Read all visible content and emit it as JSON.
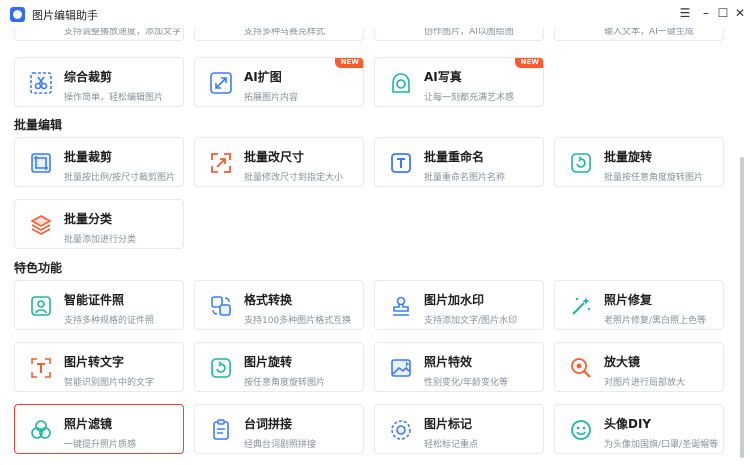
{
  "window": {
    "title": "图片编辑助手"
  },
  "top_partial": [
    {
      "desc": "支持调整播放速度，添加文字",
      "color": "#3a7bff"
    },
    {
      "desc": "支持多种马赛克样式",
      "color": "#18b7a5"
    },
    {
      "desc": "创作图片，AI以图绘图",
      "color": "#ff5a2b"
    },
    {
      "desc": "输入文本，AI一键生成",
      "color": "#3a7bff"
    }
  ],
  "featured": [
    {
      "name": "综合裁剪",
      "desc": "操作简单，轻松编辑图片",
      "icon": "crop-scissors-icon",
      "color": "#3a7bff"
    },
    {
      "name": "AI扩图",
      "desc": "拓展图片内容",
      "icon": "expand-arrows-icon",
      "color": "#3a7bff",
      "badge": "NEW"
    },
    {
      "name": "AI写真",
      "desc": "让每一刻都充满艺术感",
      "icon": "portrait-icon",
      "color": "#18b7a5",
      "badge": "NEW"
    }
  ],
  "batch": {
    "title": "批量编辑",
    "items": [
      {
        "name": "批量裁剪",
        "desc": "批量按比例/按尺寸裁剪图片",
        "icon": "batch-crop-icon",
        "color": "#3a7bff"
      },
      {
        "name": "批量改尺寸",
        "desc": "批量修改尺寸到指定大小",
        "icon": "resize-icon",
        "color": "#ff5a2b"
      },
      {
        "name": "批量重命名",
        "desc": "批量重命名图片名称",
        "icon": "rename-icon",
        "color": "#3a7bff"
      },
      {
        "name": "批量旋转",
        "desc": "批量按任意角度旋转图片",
        "icon": "rotate-icon",
        "color": "#18b7a5"
      },
      {
        "name": "批量分类",
        "desc": "批量添加进行分类",
        "icon": "layers-icon",
        "color": "#ff5a2b"
      }
    ]
  },
  "features": {
    "title": "特色功能",
    "items": [
      {
        "name": "智能证件照",
        "desc": "支持多种规格的证件照",
        "icon": "id-photo-icon",
        "color": "#18b7a5"
      },
      {
        "name": "格式转换",
        "desc": "支持100多种图片格式互换",
        "icon": "format-convert-icon",
        "color": "#3a7bff"
      },
      {
        "name": "图片加水印",
        "desc": "支持添加文字/图片水印",
        "icon": "watermark-stamp-icon",
        "color": "#3a7bff"
      },
      {
        "name": "照片修复",
        "desc": "老照片修复/黑白照上色等",
        "icon": "magic-wand-icon",
        "color": "#18b7a5"
      },
      {
        "name": "图片转文字",
        "desc": "智能识别图片中的文字",
        "icon": "text-ocr-icon",
        "color": "#ff5a2b"
      },
      {
        "name": "图片旋转",
        "desc": "按任意角度旋转图片",
        "icon": "rotate-image-icon",
        "color": "#18b7a5"
      },
      {
        "name": "照片特效",
        "desc": "性别变化/年龄变化等",
        "icon": "image-effect-icon",
        "color": "#3a7bff"
      },
      {
        "name": "放大镜",
        "desc": "对图片进行局部放大",
        "icon": "magnifier-icon",
        "color": "#ff5a2b"
      },
      {
        "name": "照片滤镜",
        "desc": "一键提升照片质感",
        "icon": "filter-circles-icon",
        "color": "#18b7a5",
        "selected": true
      },
      {
        "name": "台词拼接",
        "desc": "经典台词剧照拼接",
        "icon": "clipboard-icon",
        "color": "#3a7bff"
      },
      {
        "name": "图片标记",
        "desc": "轻松标记重点",
        "icon": "target-mark-icon",
        "color": "#3a7bff"
      },
      {
        "name": "头像DIY",
        "desc": "为头像加国旗/口罩/圣诞帽等",
        "icon": "smiley-icon",
        "color": "#18b7a5"
      }
    ]
  }
}
